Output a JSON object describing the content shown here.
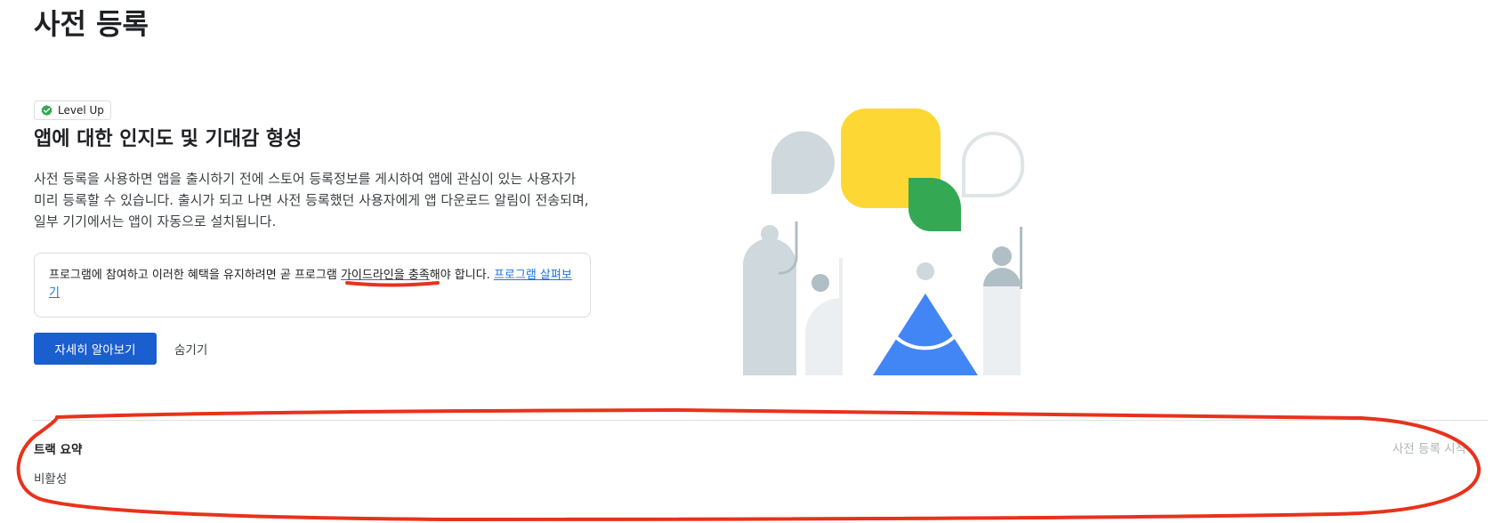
{
  "page": {
    "title": "사전 등록"
  },
  "feature_card": {
    "badge_label": "Level Up",
    "heading": "앱에 대한 인지도 및 기대감 형성",
    "description": "사전 등록을 사용하면 앱을 출시하기 전에 스토어 등록정보를 게시하여 앱에 관심이 있는 사용자가 미리 등록할 수 있습니다. 출시가 되고 나면 사전 등록했던 사용자에게 앱 다운로드 알림이 전송되며, 일부 기기에서는 앱이 자동으로 설치됩니다.",
    "notice": {
      "text_before": "프로그램에 참여하고 이러한 혜택을 유지하려면 곧 프로그램 ",
      "guideline_text": "가이드라인을 충족",
      "text_after": "해야 합니다. ",
      "link_text": "프로그램 살펴보기"
    },
    "primary_button_label": "자세히 알아보기",
    "secondary_button_label": "숨기기"
  },
  "track_summary": {
    "title": "트랙 요약",
    "status": "비활성",
    "action_label": "사전 등록 시작"
  },
  "colors": {
    "primary_blue": "#1a5ecf",
    "illustration_yellow": "#fdd835",
    "illustration_green": "#34a853",
    "illustration_blue": "#4285f4",
    "illustration_gray": "#cfd8dc",
    "annotation_red": "#e8321c"
  },
  "icons": {
    "badge_icon": "level-up-check-icon"
  }
}
